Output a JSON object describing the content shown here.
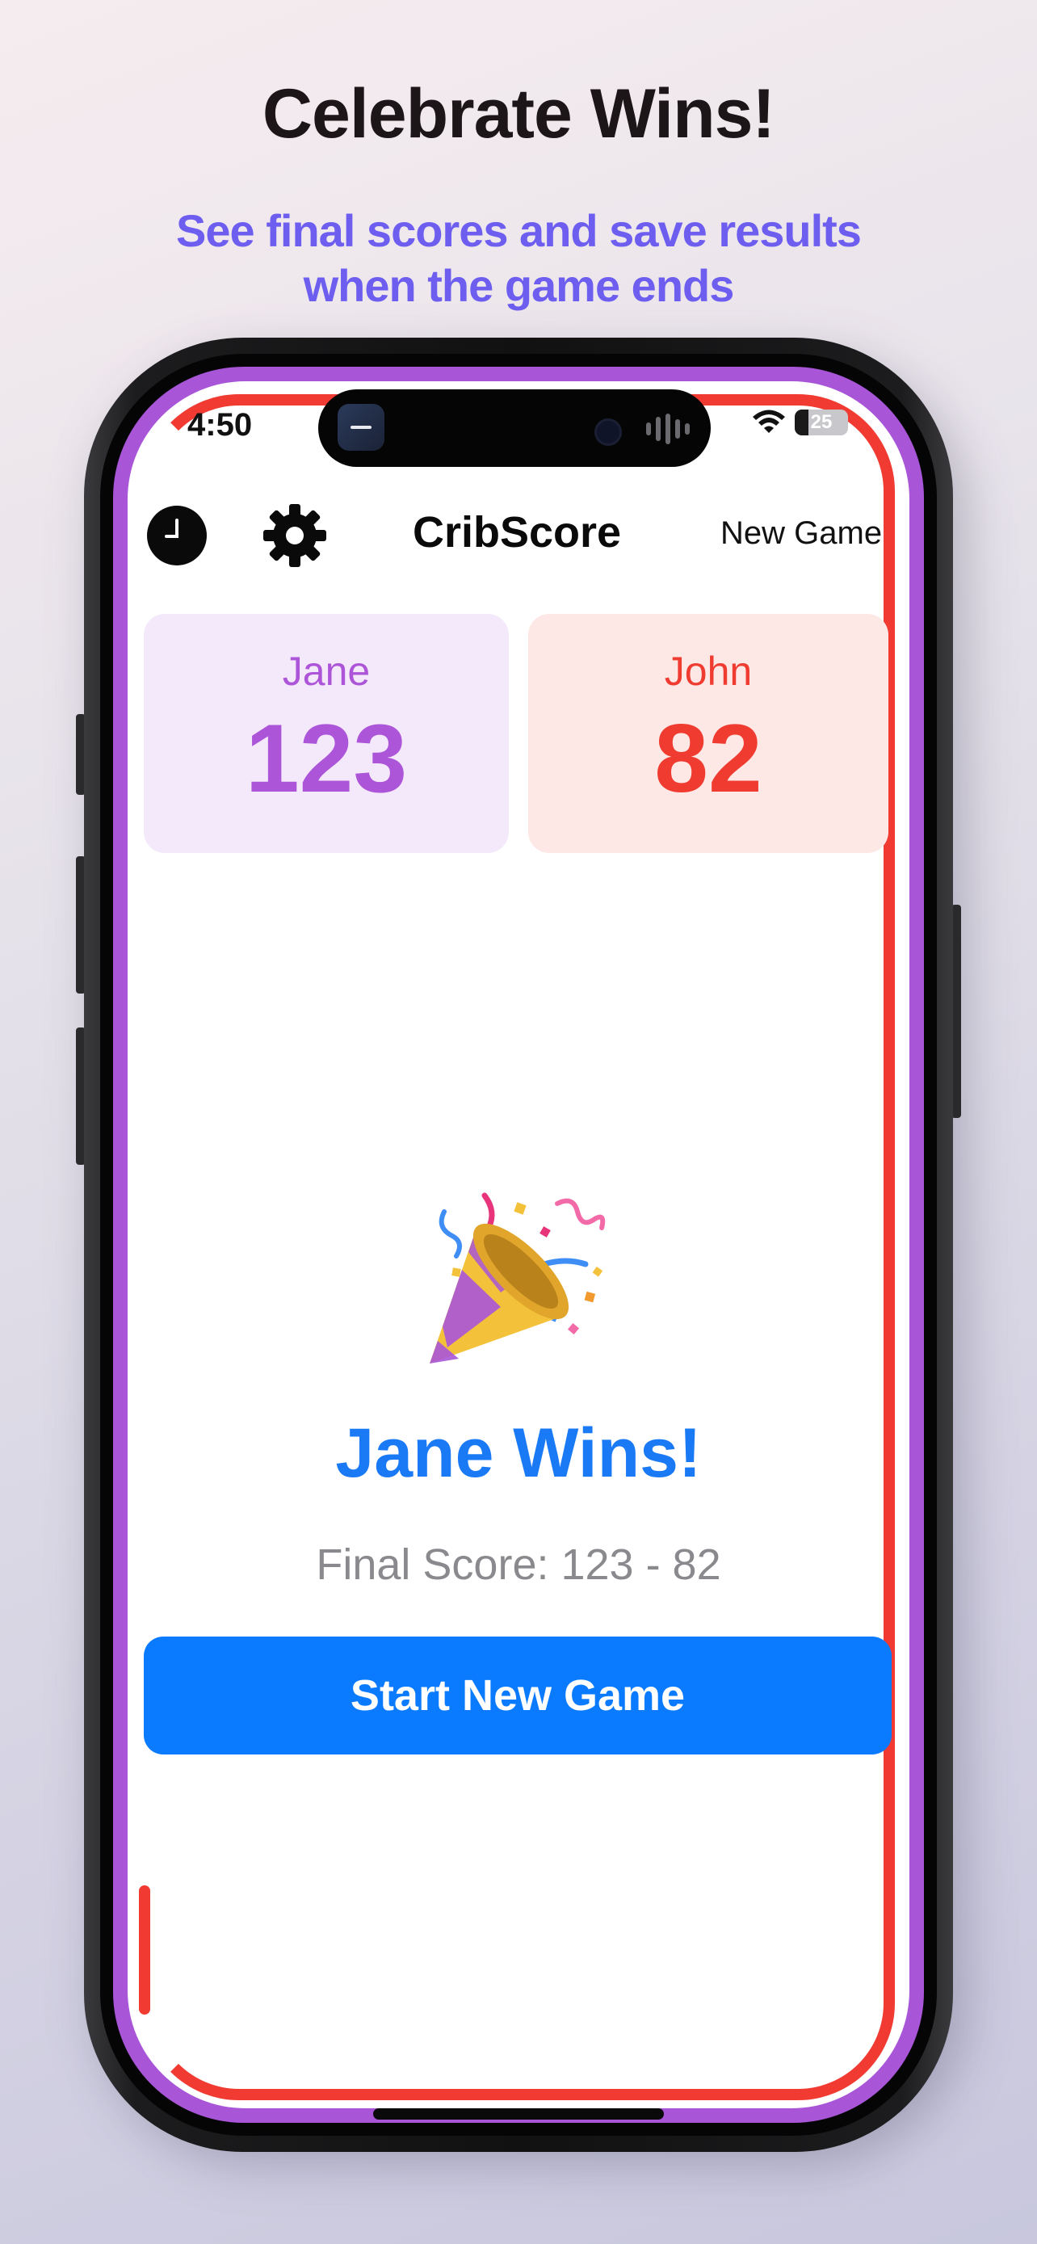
{
  "promo": {
    "title": "Celebrate Wins!",
    "subtitle": "See final scores and save results when the game ends"
  },
  "status_bar": {
    "time": "4:50",
    "battery": "25"
  },
  "nav": {
    "title": "CribScore",
    "new_game_label": "New Game"
  },
  "players": [
    {
      "name": "Jane",
      "score": "123",
      "color": "#ad55d8"
    },
    {
      "name": "John",
      "score": "82",
      "color": "#f03c30"
    }
  ],
  "result": {
    "icon": "party-popper-icon",
    "winner_text": "Jane Wins!",
    "final_score": "Final Score: 123 - 82",
    "start_button_label": "Start New Game"
  },
  "colors": {
    "accent_blue": "#0a7bff",
    "frame_purple": "#a855d8",
    "outline_red": "#f03a32",
    "subtitle_purple": "#6d5ef0"
  }
}
